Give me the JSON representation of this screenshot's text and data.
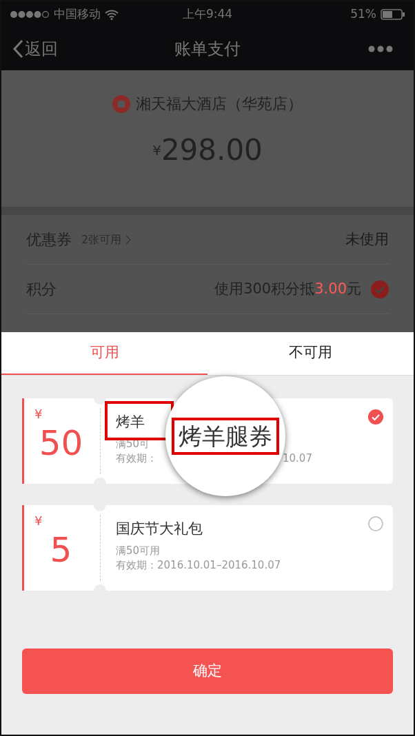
{
  "status_bar": {
    "carrier": "中国移动",
    "time": "上午9:44",
    "battery": "51%"
  },
  "nav": {
    "back": "返回",
    "title": "账单支付"
  },
  "merchant": {
    "name": "湘天福大酒店（华苑店）",
    "currency": "¥",
    "amount": "298.00"
  },
  "rows": [
    {
      "kind": "link",
      "label": "优惠券",
      "hint": "2张可用",
      "value": "未使用"
    },
    {
      "kind": "check",
      "label": "积分",
      "value_prefix": "使用300积分抵",
      "value_highlight": "3.00",
      "value_suffix": "元",
      "checked": true
    }
  ],
  "sheet": {
    "tabs": [
      {
        "label": "可用",
        "selected": true
      },
      {
        "label": "不可用",
        "selected": false
      }
    ],
    "coupons": [
      {
        "currency": "¥",
        "amount": "50",
        "title": "烤羊",
        "condition": "满50可",
        "validity": "有效期：",
        "validity_tail": "10.07",
        "selected": true
      },
      {
        "currency": "¥",
        "amount": "5",
        "title": "国庆节大礼包",
        "condition": "满50可用",
        "validity": "有效期：2016.10.01–2016.10.07",
        "selected": false
      }
    ],
    "confirm": "确定"
  },
  "magnifier": {
    "text": "烤羊腿券"
  }
}
